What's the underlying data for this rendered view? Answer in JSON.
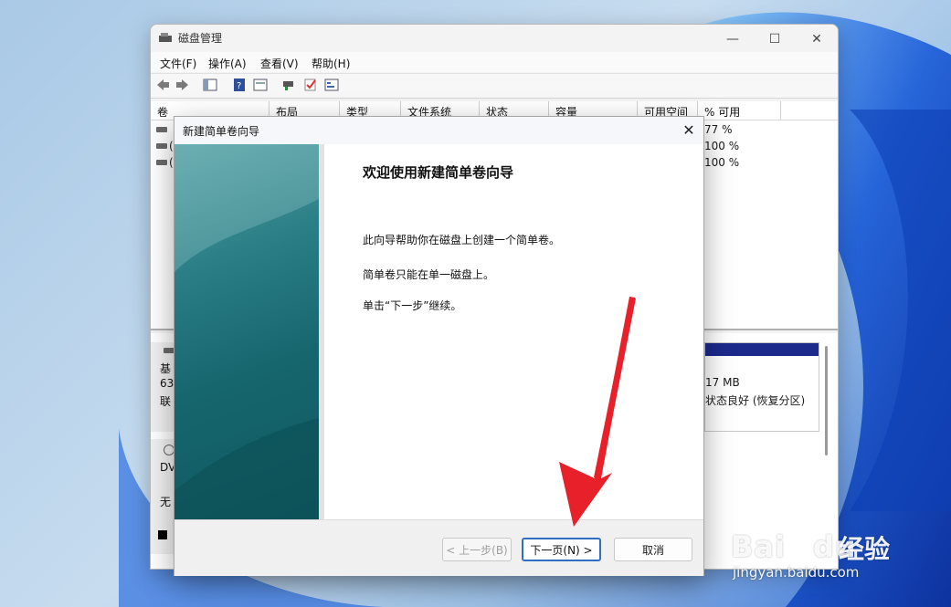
{
  "disk_management": {
    "title": "磁盘管理",
    "menu": [
      "文件(F)",
      "操作(A)",
      "查看(V)",
      "帮助(H)"
    ],
    "columns": [
      "卷",
      "布局",
      "类型",
      "文件系统",
      "状态",
      "容量",
      "可用空间",
      "% 可用"
    ],
    "rows": [
      {
        "vol": "",
        "free_pct": "77 %"
      },
      {
        "vol": "(",
        "free_pct": "100 %"
      },
      {
        "vol": "(",
        "free_pct": "100 %"
      }
    ],
    "disk0": {
      "line1": "基",
      "line2": "63",
      "line3": "联"
    },
    "dvd": {
      "line1": "DV",
      "line2": "无"
    },
    "partition": {
      "size": "17 MB",
      "status": "状态良好 (恢复分区)"
    }
  },
  "wizard": {
    "title": "新建简单卷向导",
    "heading": "欢迎使用新建简单卷向导",
    "para1": "此向导帮助你在磁盘上创建一个简单卷。",
    "para2": "简单卷只能在单一磁盘上。",
    "para3": "单击“下一步”继续。",
    "back_label": "< 上一步(B)",
    "next_label": "下一页(N) >",
    "cancel_label": "取消"
  },
  "watermark": {
    "brand": "Bai",
    "brand2": "du",
    "cn": "经验",
    "url": "jingyan.baidu.com"
  },
  "colors": {
    "accent": "#2f6fc3",
    "arrow": "#e8202a",
    "panel": "#1c6d74"
  }
}
